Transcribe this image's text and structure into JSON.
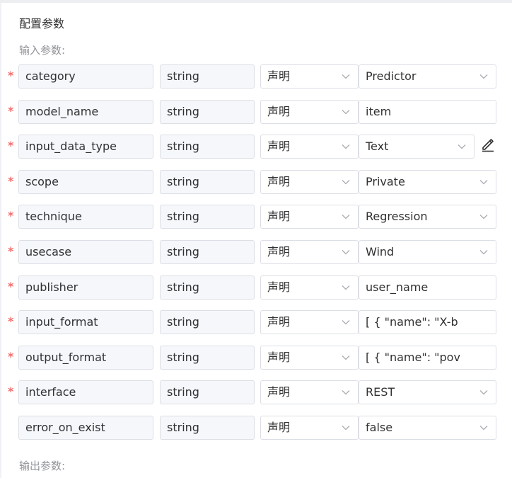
{
  "section_title": "配置参数",
  "input_label": "输入参数:",
  "output_label": "输出参数:",
  "required_mark": "*",
  "params": [
    {
      "name": "category",
      "type": "string",
      "decl": "声明",
      "value": "Predictor",
      "value_dropdown": true,
      "required": true
    },
    {
      "name": "model_name",
      "type": "string",
      "decl": "声明",
      "value": "item",
      "value_dropdown": false,
      "required": true
    },
    {
      "name": "input_data_type",
      "type": "string",
      "decl": "声明",
      "value": "Text",
      "value_dropdown": true,
      "required": true,
      "edit_icon": "pencil-icon"
    },
    {
      "name": "scope",
      "type": "string",
      "decl": "声明",
      "value": "Private",
      "value_dropdown": true,
      "required": true
    },
    {
      "name": "technique",
      "type": "string",
      "decl": "声明",
      "value": "Regression",
      "value_dropdown": true,
      "required": true
    },
    {
      "name": "usecase",
      "type": "string",
      "decl": "声明",
      "value": "Wind",
      "value_dropdown": true,
      "required": true
    },
    {
      "name": "publisher",
      "type": "string",
      "decl": "声明",
      "value": "user_name",
      "value_dropdown": false,
      "required": true
    },
    {
      "name": "input_format",
      "type": "string",
      "decl": "声明",
      "value": "[    {        \"name\": \"X-b",
      "value_dropdown": false,
      "required": true
    },
    {
      "name": "output_format",
      "type": "string",
      "decl": "声明",
      "value": "[    {        \"name\": \"pov",
      "value_dropdown": false,
      "required": true
    },
    {
      "name": "interface",
      "type": "string",
      "decl": "声明",
      "value": "REST",
      "value_dropdown": true,
      "required": true
    },
    {
      "name": "error_on_exist",
      "type": "string",
      "decl": "声明",
      "value": "false",
      "value_dropdown": true,
      "required": false
    }
  ]
}
